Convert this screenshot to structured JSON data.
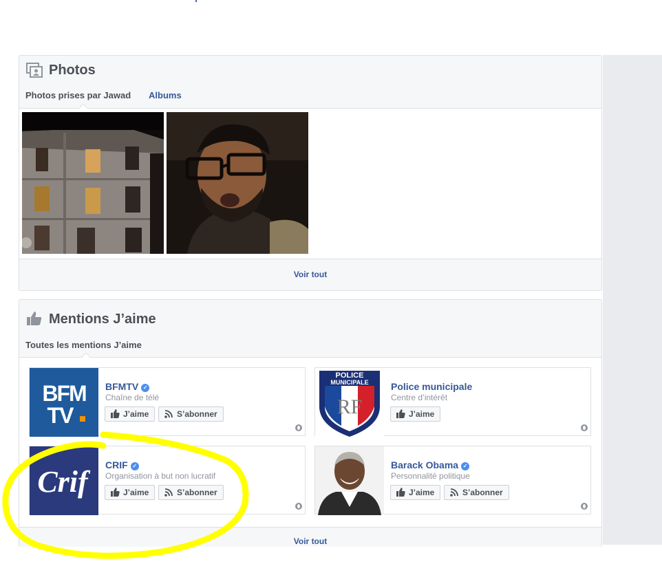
{
  "photos": {
    "title": "Photos",
    "tabs": [
      "Photos prises par Jawad",
      "Albums"
    ],
    "see_all": "Voir tout"
  },
  "likes": {
    "title": "Mentions J’aime",
    "tab": "Toutes les mentions J’aime",
    "see_all": "Voir tout",
    "like_label": "J’aime",
    "follow_label": "S’abonner",
    "items": [
      {
        "name": "BFMTV",
        "category": "Chaîne de télé",
        "logo_text": "BFM TV",
        "verified": true
      },
      {
        "name": "Police municipale",
        "category": "Centre d’intérêt",
        "logo_text": "POLICE MUNICIPALE RF",
        "verified": false
      },
      {
        "name": "CRIF",
        "category": "Organisation à but non lucratif",
        "logo_text": "Crif",
        "verified": true
      },
      {
        "name": "Barack Obama",
        "category": "Personnalité politique",
        "verified": true
      }
    ]
  },
  "colors": {
    "link": "#365899",
    "highlight": "#ffff00",
    "bfm_blue": "#1e5a9c",
    "crif_blue": "#2a3a7c"
  }
}
